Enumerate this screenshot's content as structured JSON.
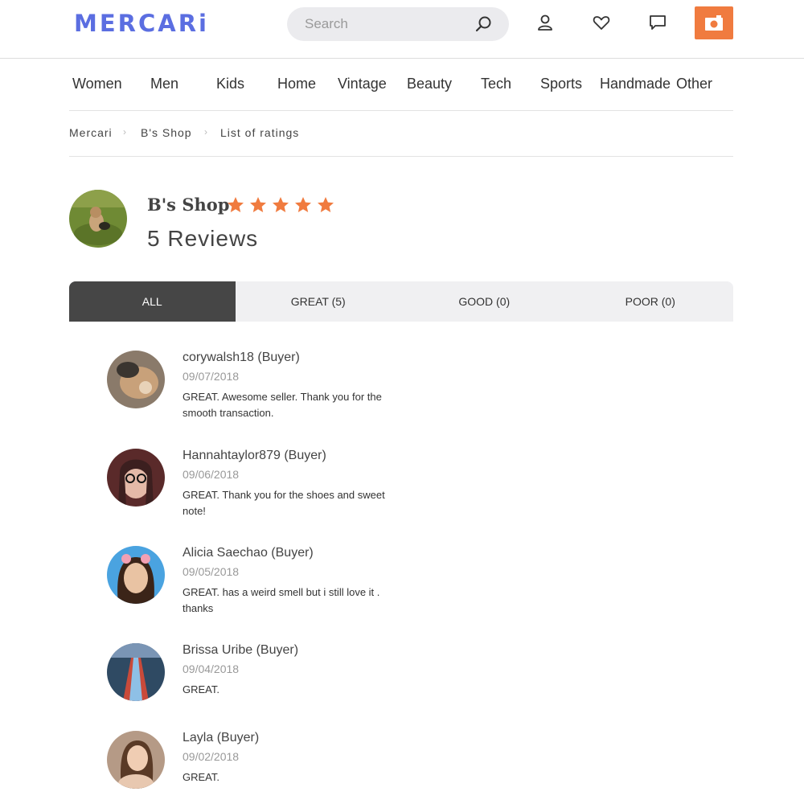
{
  "header": {
    "logo": "MERCARi",
    "search_placeholder": "Search"
  },
  "categories": [
    "Women",
    "Men",
    "Kids",
    "Home",
    "Vintage",
    "Beauty",
    "Tech",
    "Sports",
    "Handmade",
    "Other"
  ],
  "breadcrumb": [
    "Mercari",
    "B's Shop",
    "List of ratings"
  ],
  "shop": {
    "name": "B's Shop",
    "rating_stars": 5,
    "reviews_label": "5 Reviews"
  },
  "tabs": [
    {
      "label": "ALL",
      "active": true
    },
    {
      "label": "GREAT (5)",
      "active": false
    },
    {
      "label": "GOOD (0)",
      "active": false
    },
    {
      "label": "POOR (0)",
      "active": false
    }
  ],
  "reviews": [
    {
      "user": "corywalsh18 (Buyer)",
      "date": "09/07/2018",
      "text": "GREAT. Awesome seller. Thank you for the smooth transaction."
    },
    {
      "user": "Hannahtaylor879 (Buyer)",
      "date": "09/06/2018",
      "text": "GREAT. Thank you for the shoes and sweet note!"
    },
    {
      "user": "Alicia Saechao (Buyer)",
      "date": "09/05/2018",
      "text": "GREAT. has a weird smell but i still love it . thanks"
    },
    {
      "user": "Brissa Uribe (Buyer)",
      "date": "09/04/2018",
      "text": "GREAT."
    },
    {
      "user": "Layla (Buyer)",
      "date": "09/02/2018",
      "text": "GREAT."
    }
  ],
  "colors": {
    "brand": "#5b6ee1",
    "accent": "#f07b3f",
    "tab_active": "#464646"
  }
}
